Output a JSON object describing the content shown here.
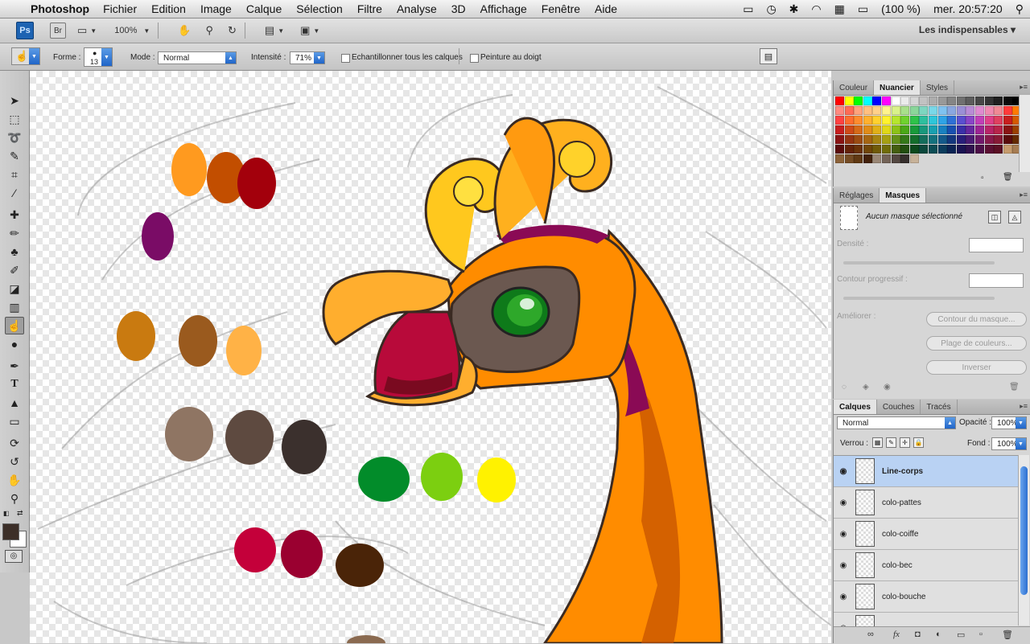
{
  "menubar": {
    "app_name": "Photoshop",
    "items": [
      "Fichier",
      "Edition",
      "Image",
      "Calque",
      "Sélection",
      "Filtre",
      "Analyse",
      "3D",
      "Affichage",
      "Fenêtre",
      "Aide"
    ],
    "battery": "(100 %)",
    "clock": "mer. 20:57:20"
  },
  "appbar": {
    "ps_badge": "Ps",
    "br_badge": "Br",
    "zoom": "100%",
    "workspace": "Les indispensables ▾"
  },
  "options": {
    "forme_label": "Forme :",
    "brush_size": "13",
    "mode_label": "Mode :",
    "mode_value": "Normal",
    "intensite_label": "Intensité :",
    "intensite_value": "71%",
    "sample_all_label": "Echantillonner tous les calques",
    "finger_paint_label": "Peinture au doigt"
  },
  "swatches_panel": {
    "tabs": [
      "Couleur",
      "Nuancier",
      "Styles"
    ],
    "active_tab": "Nuancier",
    "row1": [
      "#ff0000",
      "#ffff00",
      "#00ff00",
      "#00ffff",
      "#0000ff",
      "#ff00ff",
      "#ffffff",
      "#ebebeb",
      "#d6d6d6",
      "#c2c2c2",
      "#adadad",
      "#999999",
      "#858585",
      "#707070",
      "#5c5c5c",
      "#474747",
      "#333333",
      "#1f1f1f",
      "#0a0a0a",
      "#000000"
    ],
    "row2": [
      "#ff8a80",
      "#ff6b55",
      "#ffa37c",
      "#ffc080",
      "#ffd18a",
      "#fff38c",
      "#d9f28a",
      "#a8e08a",
      "#8ad69a",
      "#7dd6c0",
      "#79d8e8",
      "#7fc2f0",
      "#8aa7e0",
      "#9a8fd6",
      "#b98bd6",
      "#e08ad0",
      "#f08ab2",
      "#f08a95",
      "#ff3b3b",
      "#ff7a00"
    ],
    "row3": [
      "#ff4242",
      "#ff6d2e",
      "#ff8c2e",
      "#ffb12e",
      "#ffd12e",
      "#fff22e",
      "#b6e62e",
      "#6fd22e",
      "#2ec24a",
      "#2ebf9e",
      "#2ec6d9",
      "#2ea3e6",
      "#2e70d6",
      "#5a4fd0",
      "#8a45c8",
      "#c23fb8",
      "#e0408a",
      "#e04060",
      "#c81e1e",
      "#d45a00"
    ],
    "row4": [
      "#c81e1e",
      "#d04a18",
      "#d66a18",
      "#e08c18",
      "#e0b018",
      "#e0d818",
      "#8cc218",
      "#4aa818",
      "#189a3a",
      "#18987c",
      "#18a0b0",
      "#1880c0",
      "#1850b0",
      "#3a30a8",
      "#6628a0",
      "#9c2494",
      "#b82468",
      "#b8244a",
      "#8a1414",
      "#9a4000"
    ],
    "row5": [
      "#8a1414",
      "#963412",
      "#9c4c12",
      "#a66612",
      "#a68412",
      "#a6a012",
      "#64901a",
      "#34781a",
      "#146e2c",
      "#146e5c",
      "#14727e",
      "#145a8a",
      "#14387e",
      "#281f7a",
      "#4a1c74",
      "#721a6c",
      "#881a4c",
      "#881a36",
      "#5a0c0c",
      "#642a00"
    ],
    "row6": [
      "#5a0c0c",
      "#632208",
      "#6a3208",
      "#704608",
      "#705a08",
      "#706c08",
      "#445e10",
      "#224e10",
      "#0c481c",
      "#0c483c",
      "#0c4c54",
      "#0c3c5c",
      "#0c2454",
      "#1a1452",
      "#30124e",
      "#4c1048",
      "#5a1032",
      "#5a1024",
      "#c69c6d",
      "#a67c52"
    ],
    "row7": [
      "#8c6239",
      "#754c24",
      "#603913",
      "#42210b",
      "#998675",
      "#736357",
      "#534741",
      "#362f2d",
      "#c7b299"
    ]
  },
  "masks_panel": {
    "tabs": [
      "Réglages",
      "Masques"
    ],
    "active_tab": "Masques",
    "no_mask": "Aucun masque sélectionné",
    "density_label": "Densité :",
    "feather_label": "Contour progressif :",
    "refine_label": "Améliorer :",
    "btn_mask_edge": "Contour du masque...",
    "btn_color_range": "Plage de couleurs...",
    "btn_invert": "Inverser"
  },
  "layers_panel": {
    "tabs": [
      "Calques",
      "Couches",
      "Tracés"
    ],
    "active_tab": "Calques",
    "blend_mode": "Normal",
    "opacity_label": "Opacité :",
    "opacity_value": "100%",
    "lock_label": "Verrou :",
    "fill_label": "Fond :",
    "fill_value": "100%",
    "layers": [
      {
        "name": "Line-corps",
        "selected": true
      },
      {
        "name": "colo-pattes",
        "selected": false
      },
      {
        "name": "colo-coiffe",
        "selected": false
      },
      {
        "name": "colo-bec",
        "selected": false
      },
      {
        "name": "colo-bouche",
        "selected": false
      }
    ]
  },
  "palette_blobs": [
    "#ff9a1f",
    "#c24e00",
    "#a3000c",
    "#7a0c66",
    "#c97a10",
    "#9a5a1e",
    "#ffb246",
    "#8f7563",
    "#5e4a40",
    "#3b302d",
    "#028c2a",
    "#7ccf10",
    "#fff200",
    "#c4003a",
    "#9a0030",
    "#4a2408"
  ],
  "colors": {
    "foreground": "#3c2f28",
    "background": "#ffffff",
    "selection": "#b9d2f3",
    "accent": "#2e6fd0"
  }
}
